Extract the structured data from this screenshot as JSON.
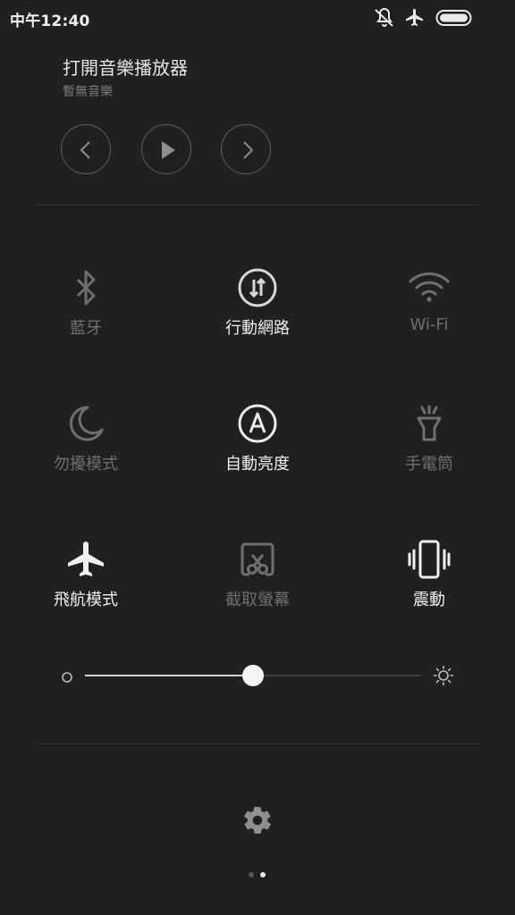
{
  "status_bar": {
    "time": "中午12:40",
    "icons": [
      "vibrate-icon",
      "airplane-icon",
      "battery-icon"
    ]
  },
  "music": {
    "title": "打開音樂播放器",
    "subtitle": "暫無音樂",
    "controls": [
      "previous-icon",
      "play-icon",
      "next-icon"
    ]
  },
  "toggles": [
    {
      "label": "藍牙",
      "state": "off",
      "icon": "bluetooth-icon"
    },
    {
      "label": "行動網路",
      "state": "on",
      "icon": "mobile-data-icon"
    },
    {
      "label": "Wi-Fi",
      "state": "off",
      "icon": "wifi-icon"
    },
    {
      "label": "勿擾模式",
      "state": "off",
      "icon": "moon-icon"
    },
    {
      "label": "自動亮度",
      "state": "on",
      "icon": "auto-brightness-icon"
    },
    {
      "label": "手電筒",
      "state": "off",
      "icon": "flashlight-icon"
    },
    {
      "label": "飛航模式",
      "state": "on",
      "icon": "airplane-icon"
    },
    {
      "label": "截取螢幕",
      "state": "off",
      "icon": "screenshot-icon"
    },
    {
      "label": "震動",
      "state": "on",
      "icon": "vibrate-icon"
    }
  ],
  "brightness": {
    "level": 0.5
  },
  "settings": {
    "icon": "gear-icon"
  },
  "pager": {
    "pages": 2,
    "current": 2
  },
  "colors": {
    "active": "#f0f0f0",
    "inactive": "#6f6f6f",
    "background": "#202022"
  }
}
